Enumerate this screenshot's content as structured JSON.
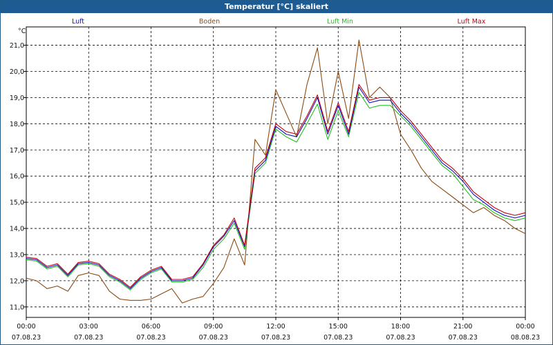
{
  "chart_data": {
    "type": "line",
    "title": "Temperatur [°C] skaliert",
    "ylabel": "°C",
    "ylim": [
      10.6,
      21.7
    ],
    "xlim_hours": [
      0,
      24
    ],
    "grid": true,
    "legend_position": "top",
    "yticks": [
      "11,0",
      "12,0",
      "13,0",
      "14,0",
      "15,0",
      "16,0",
      "17,0",
      "18,0",
      "19,0",
      "20,0",
      "21,0"
    ],
    "xticks": [
      {
        "time": "00:00",
        "date": "07.08.23"
      },
      {
        "time": "03:00",
        "date": "07.08.23"
      },
      {
        "time": "06:00",
        "date": "07.08.23"
      },
      {
        "time": "09:00",
        "date": "07.08.23"
      },
      {
        "time": "12:00",
        "date": "07.08.23"
      },
      {
        "time": "15:00",
        "date": "07.08.23"
      },
      {
        "time": "18:00",
        "date": "07.08.23"
      },
      {
        "time": "21:00",
        "date": "07.08.23"
      },
      {
        "time": "00:00",
        "date": "08.08.23"
      }
    ],
    "series": [
      {
        "name": "Luft",
        "color": "#1010c0",
        "x": [
          0,
          0.5,
          1,
          1.5,
          2,
          2.5,
          3,
          3.5,
          4,
          4.5,
          5,
          5.5,
          6,
          6.5,
          7,
          7.5,
          8,
          8.5,
          9,
          9.5,
          10,
          10.5,
          11,
          11.5,
          12,
          12.5,
          13,
          13.5,
          14,
          14.5,
          15,
          15.5,
          16,
          16.5,
          17,
          17.5,
          18,
          18.5,
          19,
          19.5,
          20,
          20.5,
          21,
          21.5,
          22,
          22.5,
          23,
          23.5,
          24
        ],
        "y": [
          12.85,
          12.8,
          12.5,
          12.6,
          12.2,
          12.65,
          12.7,
          12.6,
          12.2,
          12.0,
          11.7,
          12.1,
          12.35,
          12.5,
          12.0,
          12.0,
          12.1,
          12.6,
          13.3,
          13.7,
          14.3,
          13.3,
          16.2,
          16.6,
          17.9,
          17.6,
          17.5,
          18.2,
          19.0,
          17.6,
          18.7,
          17.6,
          19.4,
          18.8,
          18.9,
          18.9,
          18.4,
          18.0,
          17.5,
          17.0,
          16.5,
          16.2,
          15.8,
          15.3,
          15.0,
          14.7,
          14.5,
          14.4,
          14.5
        ]
      },
      {
        "name": "Boden",
        "color": "#8b4a10",
        "x": [
          0,
          0.5,
          1,
          1.5,
          2,
          2.5,
          3,
          3.5,
          4,
          4.5,
          5,
          5.5,
          6,
          6.5,
          7,
          7.5,
          8,
          8.5,
          9,
          9.5,
          10,
          10.5,
          11,
          11.5,
          12,
          12.5,
          13,
          13.5,
          14,
          14.5,
          15,
          15.5,
          16,
          16.5,
          17,
          17.5,
          18,
          18.5,
          19,
          19.5,
          20,
          20.5,
          21,
          21.5,
          22,
          22.5,
          23,
          23.5,
          24
        ],
        "y": [
          12.1,
          12.0,
          11.7,
          11.8,
          11.6,
          12.2,
          12.3,
          12.2,
          11.6,
          11.3,
          11.25,
          11.25,
          11.3,
          11.5,
          11.7,
          11.15,
          11.3,
          11.4,
          11.9,
          12.5,
          13.6,
          12.6,
          17.4,
          16.8,
          19.3,
          18.4,
          17.5,
          19.5,
          20.9,
          18.0,
          20.0,
          18.2,
          21.2,
          19.0,
          19.4,
          19.0,
          17.6,
          17.0,
          16.3,
          15.8,
          15.5,
          15.2,
          14.9,
          14.6,
          14.8,
          14.5,
          14.3,
          14.0,
          13.8
        ]
      },
      {
        "name": "Luft Min",
        "color": "#20c020",
        "x": [
          0,
          0.5,
          1,
          1.5,
          2,
          2.5,
          3,
          3.5,
          4,
          4.5,
          5,
          5.5,
          6,
          6.5,
          7,
          7.5,
          8,
          8.5,
          9,
          9.5,
          10,
          10.5,
          11,
          11.5,
          12,
          12.5,
          13,
          13.5,
          14,
          14.5,
          15,
          15.5,
          16,
          16.5,
          17,
          17.5,
          18,
          18.5,
          19,
          19.5,
          20,
          20.5,
          21,
          21.5,
          22,
          22.5,
          23,
          23.5,
          24
        ],
        "y": [
          12.8,
          12.75,
          12.45,
          12.55,
          12.15,
          12.6,
          12.65,
          12.55,
          12.15,
          11.95,
          11.65,
          12.05,
          12.3,
          12.45,
          11.95,
          11.95,
          12.05,
          12.5,
          13.2,
          13.6,
          14.2,
          13.2,
          16.1,
          16.5,
          17.8,
          17.5,
          17.3,
          18.0,
          18.75,
          17.4,
          18.5,
          17.5,
          19.2,
          18.6,
          18.7,
          18.7,
          18.3,
          17.9,
          17.4,
          16.9,
          16.4,
          16.1,
          15.6,
          15.1,
          14.9,
          14.6,
          14.4,
          14.3,
          14.4
        ]
      },
      {
        "name": "Luft Max",
        "color": "#c00010",
        "x": [
          0,
          0.5,
          1,
          1.5,
          2,
          2.5,
          3,
          3.5,
          4,
          4.5,
          5,
          5.5,
          6,
          6.5,
          7,
          7.5,
          8,
          8.5,
          9,
          9.5,
          10,
          10.5,
          11,
          11.5,
          12,
          12.5,
          13,
          13.5,
          14,
          14.5,
          15,
          15.5,
          16,
          16.5,
          17,
          17.5,
          18,
          18.5,
          19,
          19.5,
          20,
          20.5,
          21,
          21.5,
          22,
          22.5,
          23,
          23.5,
          24
        ],
        "y": [
          12.9,
          12.85,
          12.55,
          12.65,
          12.25,
          12.7,
          12.75,
          12.65,
          12.25,
          12.05,
          11.75,
          12.15,
          12.4,
          12.55,
          12.05,
          12.05,
          12.15,
          12.65,
          13.35,
          13.75,
          14.4,
          13.35,
          16.3,
          16.7,
          18.0,
          17.7,
          17.6,
          18.3,
          19.1,
          17.7,
          18.8,
          17.7,
          19.5,
          18.9,
          19.0,
          19.0,
          18.5,
          18.1,
          17.6,
          17.1,
          16.6,
          16.3,
          15.9,
          15.4,
          15.1,
          14.8,
          14.6,
          14.5,
          14.6
        ]
      }
    ]
  }
}
